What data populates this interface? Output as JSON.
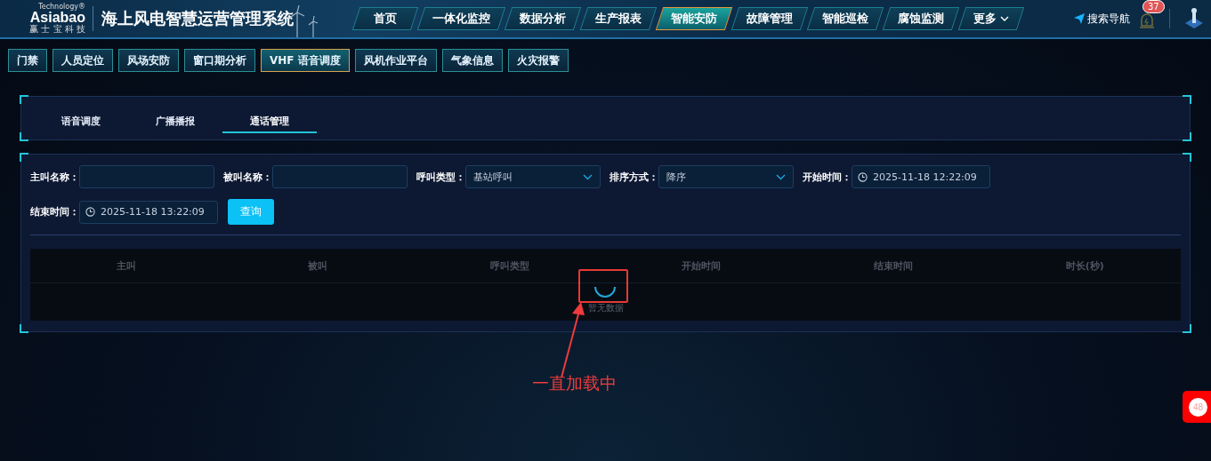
{
  "header": {
    "logo_tagline": "Technology®",
    "logo_name": "Asiabao",
    "logo_sub": "赢 士 宝 科 技",
    "title": "海上风电智慧运营管理系统",
    "nav": [
      {
        "label": "首页",
        "selected": false
      },
      {
        "label": "一体化监控",
        "selected": false
      },
      {
        "label": "数据分析",
        "selected": false
      },
      {
        "label": "生产报表",
        "selected": false
      },
      {
        "label": "智能安防",
        "selected": true
      },
      {
        "label": "故障管理",
        "selected": false
      },
      {
        "label": "智能巡检",
        "selected": false
      },
      {
        "label": "腐蚀监测",
        "selected": false
      },
      {
        "label": "更多",
        "selected": false,
        "kind": "dropdown"
      }
    ],
    "search_nav": "搜索导航",
    "alarm_count": "37"
  },
  "subnav": [
    {
      "label": "门禁",
      "selected": false
    },
    {
      "label": "人员定位",
      "selected": false
    },
    {
      "label": "风场安防",
      "selected": false
    },
    {
      "label": "窗口期分析",
      "selected": false
    },
    {
      "label": "VHF 语音调度",
      "selected": true
    },
    {
      "label": "风机作业平台",
      "selected": false
    },
    {
      "label": "气象信息",
      "selected": false
    },
    {
      "label": "火灾报警",
      "selected": false
    }
  ],
  "tabs": [
    {
      "label": "语音调度",
      "selected": false
    },
    {
      "label": "广播播报",
      "selected": false
    },
    {
      "label": "通话管理",
      "selected": true
    }
  ],
  "filters": [
    {
      "label": "主叫名称：",
      "kind": "text"
    },
    {
      "label": "被叫名称：",
      "kind": "text"
    },
    {
      "label": "呼叫类型：",
      "kind": "select",
      "value": "基站呼叫"
    },
    {
      "label": "排序方式：",
      "kind": "select",
      "value": "降序"
    },
    {
      "label": "开始时间：",
      "kind": "datetime",
      "value": "2025-11-18 12:22:09"
    },
    {
      "label": "结束时间：",
      "kind": "datetime",
      "value": "2025-11-18 13:22:09"
    }
  ],
  "query_button": "查询",
  "table": {
    "columns": [
      "主叫",
      "被叫",
      "呼叫类型",
      "开始时间",
      "结束时间",
      "时长(秒)"
    ],
    "empty_text": "暂无数据",
    "loading": true
  },
  "annotation": "一直加载中",
  "float_badge": "48"
}
